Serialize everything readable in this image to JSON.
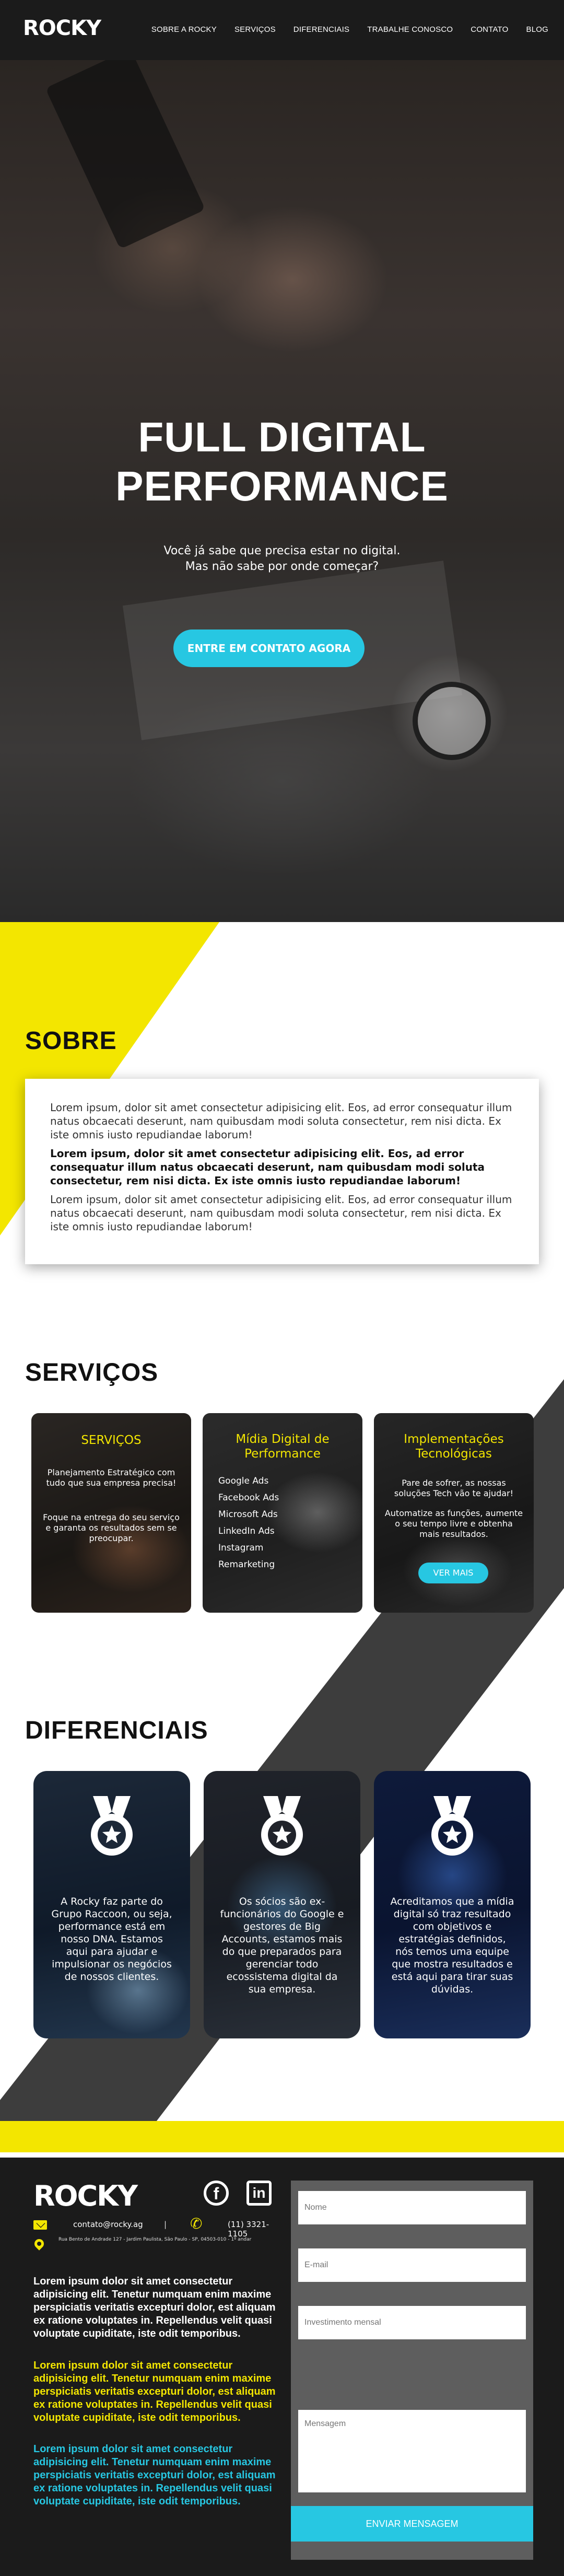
{
  "brand": {
    "logo": "ROCKY"
  },
  "nav": {
    "items": [
      "SOBRE A ROCKY",
      "SERVIÇOS",
      "DIFERENCIAIS",
      "TRABALHE CONOSCO",
      "CONTATO",
      "BLOG"
    ]
  },
  "hero": {
    "title_line1": "FULL DIGITAL",
    "title_line2": "PERFORMANCE",
    "subtitle_line1": "Você já sabe que precisa estar no digital.",
    "subtitle_line2": "Mas não sabe por onde começar?",
    "cta": "ENTRE EM CONTATO AGORA"
  },
  "sobre": {
    "title": "SOBRE",
    "paragraphs": [
      "Lorem ipsum, dolor sit amet consectetur adipisicing elit. Eos, ad error consequatur illum natus obcaecati deserunt, nam quibusdam modi soluta consectetur, rem nisi dicta. Ex iste omnis iusto repudiandae laborum!",
      "Lorem ipsum, dolor sit amet consectetur adipisicing elit. Eos, ad error consequatur illum natus obcaecati deserunt, nam quibusdam modi soluta consectetur, rem nisi dicta. Ex iste omnis iusto repudiandae laborum!",
      "Lorem ipsum, dolor sit amet consectetur adipisicing elit. Eos, ad error consequatur illum natus obcaecati deserunt, nam quibusdam modi soluta consectetur, rem nisi dicta. Ex iste omnis iusto repudiandae laborum!"
    ]
  },
  "servicos": {
    "title": "SERVIÇOS",
    "cards": [
      {
        "title": "SERVIÇOS",
        "text1": "Planejamento Estratégico com tudo que sua empresa precisa!",
        "text2": "Foque na entrega do seu serviço e garanta os resultados sem se preocupar."
      },
      {
        "title": "Mídia Digital de Performance",
        "items": [
          "Google Ads",
          "Facebook Ads",
          "Microsoft Ads",
          "LinkedIn Ads",
          "Instagram",
          "Remarketing"
        ]
      },
      {
        "title": "Implementações Tecnológicas",
        "text1": "Pare de sofrer, as nossas soluções Tech vão te ajudar!",
        "text2": "Automatize as funções, aumente o seu tempo livre e obtenha mais resultados.",
        "button": "VER MAIS"
      }
    ]
  },
  "diferenciais": {
    "title": "DIFERENCIAIS",
    "cards": [
      {
        "text": "A Rocky faz parte do Grupo Raccoon, ou seja, performance está em nosso DNA. Estamos aqui para ajudar e impulsionar os negócios de nossos clientes."
      },
      {
        "text": "Os sócios são ex-funcionários do Google e gestores de Big Accounts, estamos mais do que preparados para gerenciar todo ecossistema digital da sua empresa."
      },
      {
        "text": "Acreditamos que a mídia digital só traz resultado com objetivos e estratégias definidos, nós temos uma equipe que mostra resultados e está aqui para tirar suas dúvidas."
      }
    ]
  },
  "footer": {
    "logo": "ROCKY",
    "facebook": "f",
    "linkedin": "in",
    "email": "contato@rocky.ag",
    "separator": "|",
    "phone": "(11) 3321-1105",
    "address": "Rua Bento de Andrade 127 - Jardim Paulista, São Paulo - SP, 04503-010 - 1º andar",
    "text_white": "Lorem ipsum dolor sit amet consectetur adipisicing elit. Tenetur numquam enim maxime perspiciatis veritatis excepturi dolor, est aliquam ex ratione voluptates in. Repellendus velit quasi voluptate cupiditate, iste odit temporibus.",
    "text_yellow": "Lorem ipsum dolor sit amet consectetur adipisicing elit. Tenetur numquam enim maxime perspiciatis veritatis excepturi dolor, est aliquam ex ratione voluptates in. Repellendus velit quasi voluptate cupiditate, iste odit temporibus.",
    "text_cyan": "Lorem ipsum dolor sit amet consectetur adipisicing elit. Tenetur numquam enim maxime perspiciatis veritatis excepturi dolor, est aliquam ex ratione voluptates in. Repellendus velit quasi voluptate cupiditate, iste odit temporibus."
  },
  "form": {
    "name_placeholder": "Nome",
    "email_placeholder": "E-mail",
    "budget_placeholder": "Investimento mensal",
    "message_placeholder": "Mensagem",
    "submit": "ENVIAR MENSAGEM"
  },
  "colors": {
    "accent_cyan": "#27c7e2",
    "accent_yellow": "#f3e600",
    "dark": "#1b1b1b",
    "diagonal_gray": "#3d3d3d",
    "form_gray": "#5e5e5e"
  }
}
